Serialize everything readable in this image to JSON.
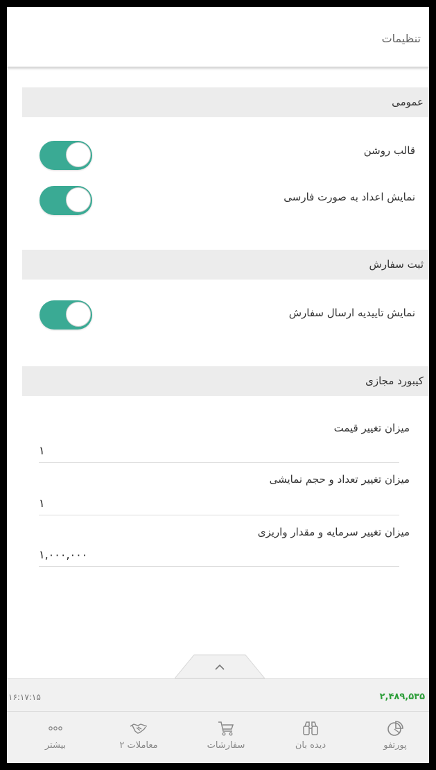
{
  "header": {
    "title": "تنظیمات"
  },
  "sections": {
    "general": {
      "title": "عمومی",
      "light_theme_label": "قالب روشن",
      "persian_numbers_label": "نمایش اعداد به صورت فارسی",
      "light_theme_on": true,
      "persian_numbers_on": true
    },
    "order": {
      "title": "ثبت سفارش",
      "confirm_label": "نمایش تاییدیه ارسال سفارش",
      "confirm_on": true
    },
    "keyboard": {
      "title": "کیبورد مجازی",
      "price_step_label": "میزان تغییر قیمت",
      "price_step_value": "۱",
      "qty_step_label": "میزان تغییر تعداد و حجم نمایشی",
      "qty_step_value": "۱",
      "capital_step_label": "میزان تغییر سرمایه و مقدار واریزی",
      "capital_step_value": "۱,۰۰۰,۰۰۰"
    }
  },
  "status": {
    "time": "۱۶:۱۷:۱۵",
    "value": "۲,۴۸۹,۵۳۵",
    "value_color": "#2e9e3a"
  },
  "accent_color": "#3aaa94",
  "bottom_nav": [
    {
      "label": "پورتفو",
      "icon": "pie-chart-icon"
    },
    {
      "label": "دیده بان",
      "icon": "binoculars-icon"
    },
    {
      "label": "سفارشات",
      "icon": "cart-icon"
    },
    {
      "label": "معاملات ۲",
      "icon": "handshake-icon"
    },
    {
      "label": "بیشتر",
      "icon": "more-dots-icon"
    }
  ]
}
